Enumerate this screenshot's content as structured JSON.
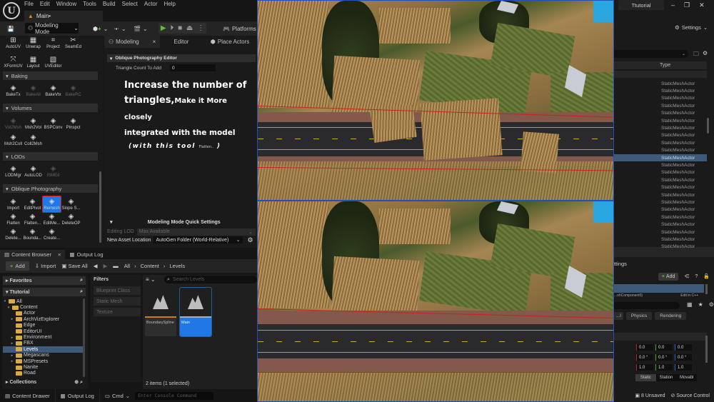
{
  "menubar": [
    "File",
    "Edit",
    "Window",
    "Tools",
    "Build",
    "Select",
    "Actor",
    "Help"
  ],
  "level_tab": "Main•",
  "project_tab": "Ttutorial",
  "window_controls": {
    "minimize": "–",
    "restore": "❐",
    "close": "✕"
  },
  "toolbar": {
    "mode_selector": "Modeling Mode",
    "platforms": "Platforms",
    "settings": "Settings"
  },
  "modeling_tools": {
    "uv_tools": [
      {
        "label": "AutoUV",
        "icon": "auto-uv-icon"
      },
      {
        "label": "Unwrap",
        "icon": "unwrap-icon"
      },
      {
        "label": "Project",
        "icon": "project-icon"
      },
      {
        "label": "SeamEd",
        "icon": "seam-edit-icon"
      },
      {
        "label": "XFormUV",
        "icon": "xform-uv-icon"
      },
      {
        "label": "Layout",
        "icon": "layout-icon"
      },
      {
        "label": "UVEditor",
        "icon": "uv-editor-icon"
      }
    ],
    "sections": {
      "baking": "Baking",
      "volumes": "Volumes",
      "lods": "LODs",
      "oblique": "Oblique Photography"
    },
    "baking_tools": [
      {
        "label": "BakeTx",
        "dim": false
      },
      {
        "label": "BakeAll",
        "dim": true
      },
      {
        "label": "BakeVtx",
        "dim": false
      },
      {
        "label": "BakeRC",
        "dim": true
      }
    ],
    "volume_tools": [
      {
        "label": "Vol2Msh",
        "dim": true
      },
      {
        "label": "Msh2Vol",
        "dim": false
      },
      {
        "label": "BSPConv",
        "dim": false
      },
      {
        "label": "PInspct",
        "dim": false
      },
      {
        "label": "Msh2Coll",
        "dim": false
      },
      {
        "label": "Coll2Msh",
        "dim": false
      }
    ],
    "lod_tools": [
      {
        "label": "LODMgr",
        "dim": false
      },
      {
        "label": "AutoLOD",
        "dim": false
      },
      {
        "label": "ISMEd",
        "dim": true
      }
    ],
    "oblique_tools": [
      {
        "label": "Import"
      },
      {
        "label": "EditPivot"
      },
      {
        "label": "Remesh",
        "selected": true
      },
      {
        "label": "Slope S..."
      },
      {
        "label": "Flatten"
      },
      {
        "label": "Flatten..."
      },
      {
        "label": "EditMe..."
      },
      {
        "label": "DeleteOP"
      },
      {
        "label": "Delete..."
      },
      {
        "label": "Bounda..."
      },
      {
        "label": "Create..."
      }
    ]
  },
  "modeling_panel": {
    "tabs": [
      {
        "label": "Modeling",
        "active": true,
        "closable": true
      },
      {
        "label": "Editor",
        "active": false
      },
      {
        "label": "Place Actors",
        "active": false
      }
    ],
    "section_title": "Oblique Photography Editor",
    "triangle_count_label": "Triangle Count To Add",
    "triangle_count_value": "0",
    "annotation": {
      "line1": "Increase the number of",
      "line2_big": "triangles,",
      "line2_small": "Make it More closely",
      "line3": "integrated with the model",
      "line4_open": "(with this tool",
      "line4_tool": "Flatten..",
      "line4_close": ")"
    },
    "quick_settings_title": "Modeling Mode Quick Settings",
    "editing_lod_label": "Editing LOD",
    "editing_lod_value": "Max Available",
    "new_asset_location_label": "New Asset Location",
    "new_asset_location_value": "AutoGen Folder (World-Relative)"
  },
  "content_browser": {
    "tabs": [
      {
        "label": "Content Browser",
        "active": true
      },
      {
        "label": "Output Log",
        "active": false
      }
    ],
    "add": "Add",
    "import": "Import",
    "save_all": "Save All",
    "breadcrumb": [
      "All",
      "Content",
      "Levels"
    ],
    "favorites": "Favorites",
    "project": "Ttutorial",
    "tree": [
      {
        "label": "All",
        "depth": 0,
        "expanded": true,
        "arrow": true
      },
      {
        "label": "Content",
        "depth": 1,
        "expanded": true,
        "arrow": true
      },
      {
        "label": "Actor",
        "depth": 2,
        "arrow": false
      },
      {
        "label": "ArchVizExplorer",
        "depth": 2,
        "arrow": true
      },
      {
        "label": "Edge",
        "depth": 2,
        "arrow": false
      },
      {
        "label": "EditorUI",
        "depth": 2,
        "arrow": false
      },
      {
        "label": "Environment",
        "depth": 2,
        "arrow": true
      },
      {
        "label": "FBX",
        "depth": 2,
        "arrow": true
      },
      {
        "label": "Levels",
        "depth": 2,
        "arrow": false,
        "selected": true
      },
      {
        "label": "Megascans",
        "depth": 2,
        "arrow": true
      },
      {
        "label": "MSPresets",
        "depth": 2,
        "arrow": true
      },
      {
        "label": "Nanite",
        "depth": 2,
        "arrow": false
      },
      {
        "label": "Road",
        "depth": 2,
        "arrow": false
      }
    ],
    "collections": "Collections",
    "filters_title": "Filters",
    "filters": [
      "Blueprint Class",
      "Static Mesh",
      "Texture"
    ],
    "search_placeholder": "Search Levels",
    "assets": [
      {
        "label": "BoundarySpline",
        "selected": false,
        "accent": "#d07a1a"
      },
      {
        "label": "Main",
        "selected": true,
        "accent": "#d07a1a"
      }
    ],
    "item_count": "2 items (1 selected)"
  },
  "status_bar": {
    "content_drawer": "Content Drawer",
    "output_log": "Output Log",
    "cmd": "Cmd",
    "console_placeholder": "Enter Console Command",
    "unsaved": "8 Unsaved",
    "source_control": "Source Control"
  },
  "outliner": {
    "type_header": "Type",
    "rows": [
      {
        "type": "StaticMeshActor"
      },
      {
        "type": "StaticMeshActor"
      },
      {
        "type": "StaticMeshActor"
      },
      {
        "type": "StaticMeshActor"
      },
      {
        "type": "StaticMeshActor"
      },
      {
        "type": "StaticMeshActor"
      },
      {
        "type": "StaticMeshActor"
      },
      {
        "type": "StaticMeshActor"
      },
      {
        "type": "StaticMeshActor"
      },
      {
        "type": "StaticMeshActor"
      },
      {
        "type": "StaticMeshActor",
        "selected": true
      },
      {
        "type": "StaticMeshActor"
      },
      {
        "type": "StaticMeshActor"
      },
      {
        "type": "StaticMeshActor"
      },
      {
        "type": "StaticMeshActor"
      },
      {
        "type": "StaticMeshActor"
      },
      {
        "type": "StaticMeshActor"
      },
      {
        "type": "StaticMeshActor"
      },
      {
        "type": "StaticMeshActor"
      },
      {
        "type": "StaticMeshActor"
      },
      {
        "type": "StaticMeshActor"
      },
      {
        "type": "StaticMeshActor"
      },
      {
        "type": "StaticMeshActor"
      }
    ]
  },
  "details": {
    "title_partial": "ttings",
    "add": "Add",
    "component_partial": "...ohComponent0)",
    "edit_partial": "Edit in C++",
    "categories": [
      "...l",
      "Physics",
      "Rendering"
    ],
    "location": [
      "0.0",
      "0.0",
      "0.0"
    ],
    "rotation": [
      "0.0 °",
      "0.0 °",
      "0.0 °"
    ],
    "scale": [
      "1.0",
      "1.0",
      "1.0"
    ],
    "mobility": [
      {
        "label": "Static",
        "active": true
      },
      {
        "label": "Station",
        "active": false
      },
      {
        "label": "Movabl",
        "active": false
      }
    ]
  },
  "colors": {
    "accent_blue": "#1f78e6",
    "selection_row": "#3f5a78",
    "highlight_red": "#d02020",
    "add_green": "#5bbf3a",
    "folder": "#d8a945"
  }
}
